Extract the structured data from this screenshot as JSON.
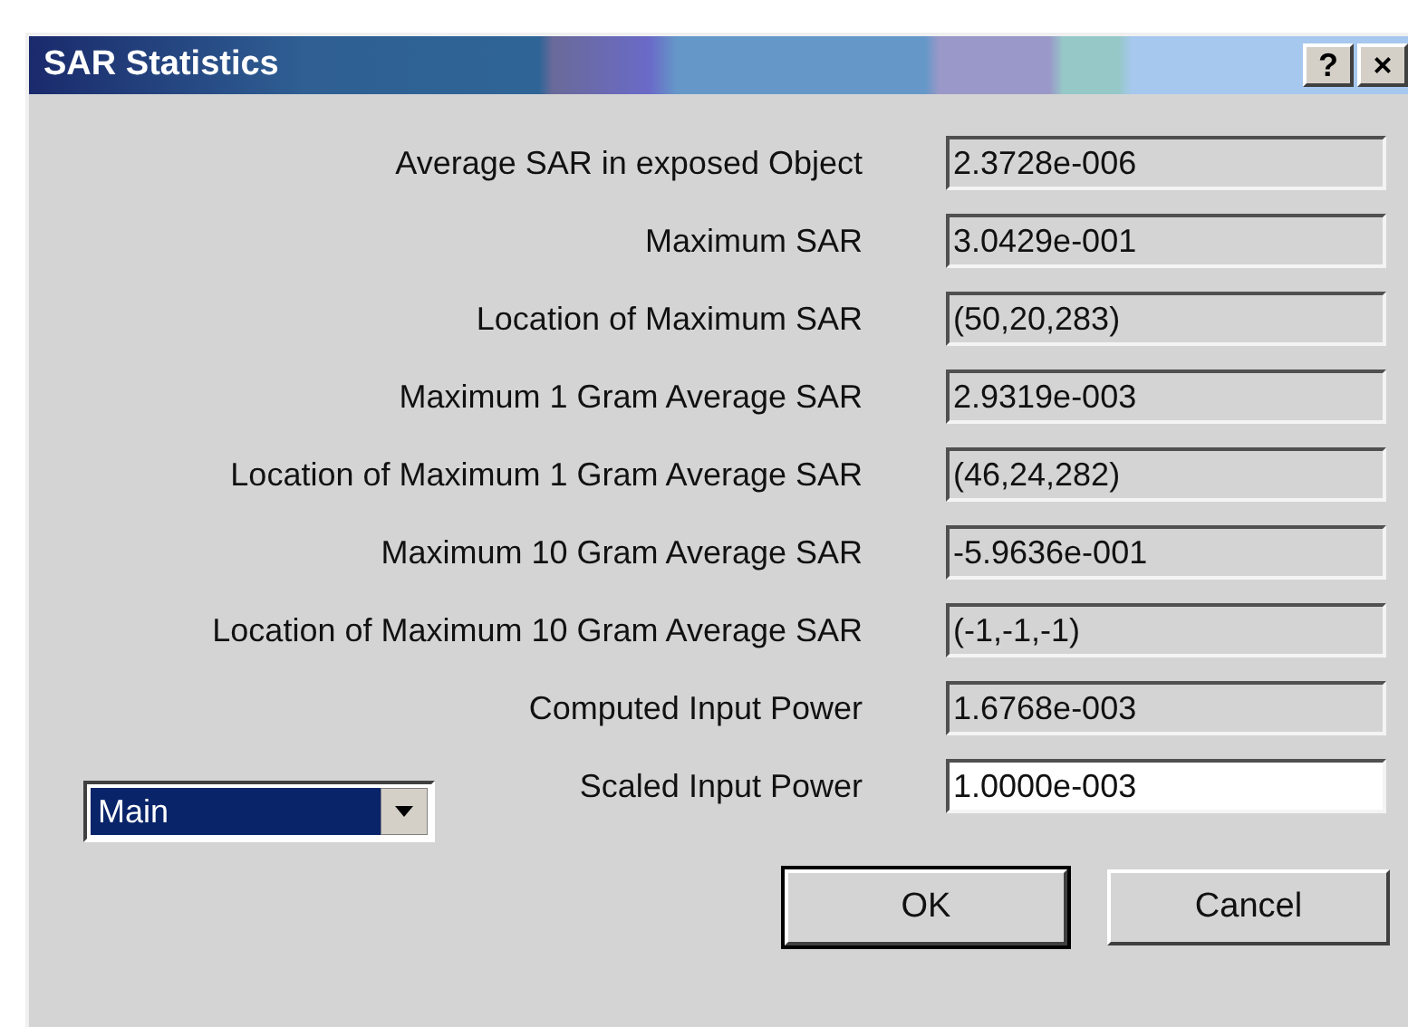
{
  "window": {
    "title": "SAR Statistics",
    "buttons": [
      "?",
      "×"
    ]
  },
  "fields": [
    {
      "label": "Average SAR in exposed Object",
      "value": "2.3728e-006",
      "kind": "readonly"
    },
    {
      "label": "Maximum SAR",
      "value": "3.0429e-001",
      "kind": "readonly"
    },
    {
      "label": "Location of Maximum SAR",
      "value": "(50,20,283)",
      "kind": "readonly"
    },
    {
      "label": "Maximum 1 Gram Average SAR",
      "value": "2.9319e-003",
      "kind": "readonly"
    },
    {
      "label": "Location of Maximum 1 Gram Average SAR",
      "value": "(46,24,282)",
      "kind": "readonly"
    },
    {
      "label": "Maximum 10 Gram Average SAR",
      "value": "-5.9636e-001",
      "kind": "readonly"
    },
    {
      "label": "Location of Maximum 10 Gram Average SAR",
      "value": "(-1,-1,-1)",
      "kind": "readonly"
    },
    {
      "label": "Computed Input Power",
      "value": "1.6768e-003",
      "kind": "readonly"
    },
    {
      "label": "Scaled Input Power",
      "value": "1.0000e-003",
      "kind": "editable"
    }
  ],
  "dropdown": {
    "value": "Main",
    "selected": true
  },
  "buttons": [
    {
      "label": "OK",
      "default": true
    },
    {
      "label": "Cancel",
      "default": false
    }
  ]
}
